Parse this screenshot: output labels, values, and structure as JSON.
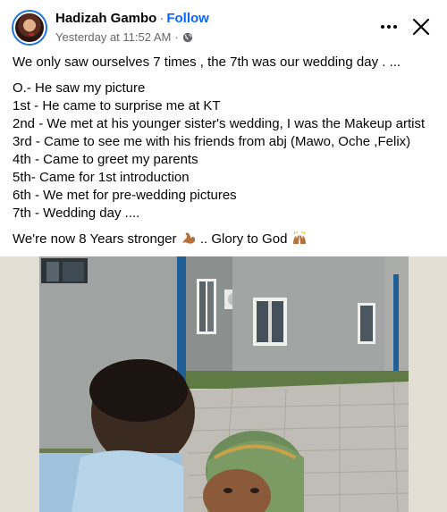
{
  "post": {
    "author": "Hadizah Gambo",
    "separator": "·",
    "follow_label": "Follow",
    "timestamp": "Yesterday at 11:52 AM",
    "meta_separator": "·",
    "privacy_icon": "globe-icon",
    "more_icon": "more-options-icon",
    "close_icon": "close-icon"
  },
  "content": {
    "intro": "We only saw ourselves 7 times , the 7th was our wedding day .  ...",
    "lines": [
      "O.-    He saw my picture",
      "1st -  He came to surprise me at KT",
      "2nd - We met at his younger sister's wedding, I was   the Makeup artist",
      "3rd - Came to see me with his friends from abj (Mawo, Oche ,Felix)",
      "4th - Came to greet my parents",
      "5th- Came for 1st introduction",
      "6th - We met for pre-wedding pictures",
      "7th - Wedding day ...."
    ],
    "outro_before": "We're now 8 Years stronger",
    "outro_middle": ".. Glory to God",
    "emoji_1": "flexed-biceps-icon",
    "emoji_2": "raising-hands-icon"
  },
  "colors": {
    "accent": "#0866ff",
    "text": "#050505",
    "secondary_text": "#65676b"
  }
}
